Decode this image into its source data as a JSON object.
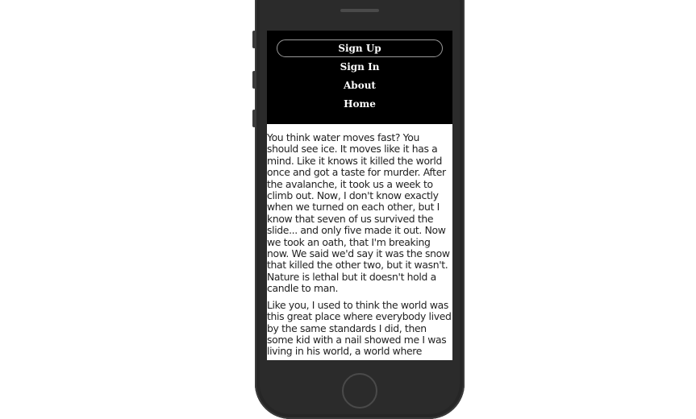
{
  "nav": {
    "items": [
      {
        "label": "Sign Up",
        "active": true
      },
      {
        "label": "Sign In",
        "active": false
      },
      {
        "label": "About",
        "active": false
      },
      {
        "label": "Home",
        "active": false
      }
    ]
  },
  "content": {
    "paragraphs": [
      "You think water moves fast? You should see ice. It moves like it has a mind. Like it knows it killed the world once and got a taste for murder. After the avalanche, it took us a week to climb out. Now, I don't know exactly when we turned on each other, but I know that seven of us survived the slide... and only five made it out. Now we took an oath, that I'm breaking now. We said we'd say it was the snow that killed the other two, but it wasn't. Nature is lethal but it doesn't hold a candle to man.",
      "Like you, I used to think the world was this great place where everybody lived by the same standards I did, then some kid with a nail showed me I was living in his world, a world where"
    ]
  },
  "colors": {
    "nav_background": "#000000",
    "phone_body": "#2b2b2b",
    "text": "#222222"
  }
}
